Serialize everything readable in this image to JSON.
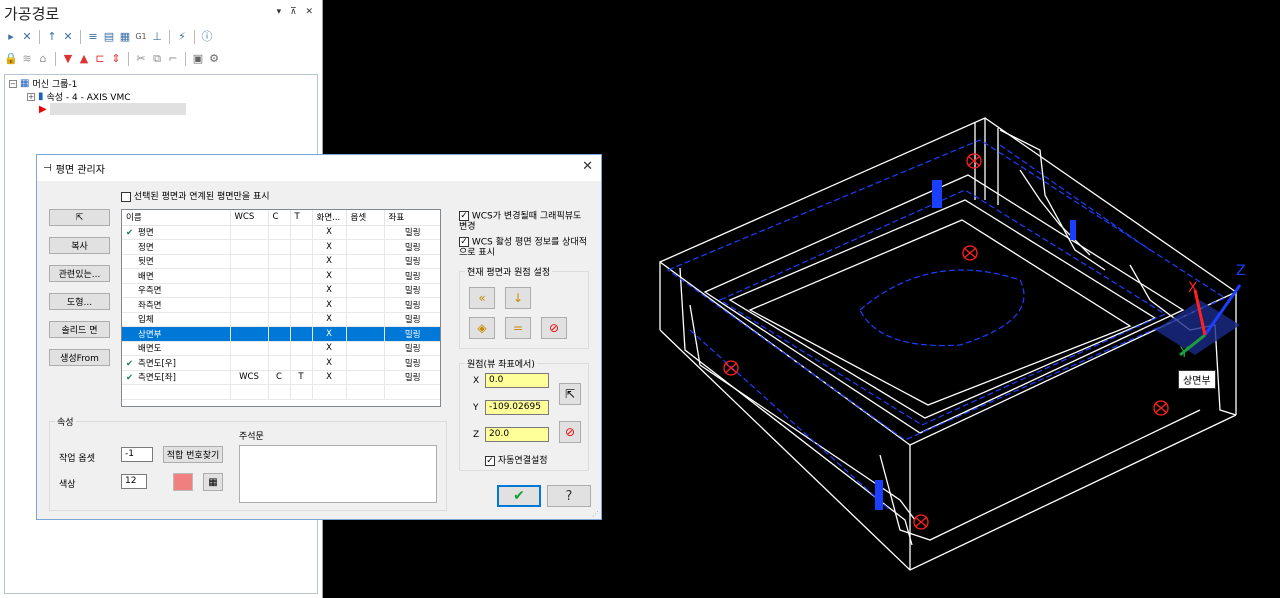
{
  "panel": {
    "title": "가공경로",
    "tree": {
      "machine_group": "머신 그룹-1",
      "properties": "속성 - 4 - AXIS VMC"
    }
  },
  "dialog": {
    "title": "평면 관리자",
    "filter_checkbox_label": "선택된 평면과 연계된 평면만을 표시",
    "left_buttons": [
      "",
      "복사",
      "관련있는...",
      "도형...",
      "솔리드 면",
      "생성From"
    ],
    "columns": [
      "이름",
      "WCS",
      "C",
      "T",
      "화면...",
      "옵셋",
      "좌표"
    ],
    "rows": [
      {
        "check": true,
        "name": "평면",
        "wcs": "",
        "c": "",
        "t": "",
        "screen": "X",
        "offset": "",
        "coord": "밀링",
        "selected": false
      },
      {
        "check": false,
        "name": "정면",
        "wcs": "",
        "c": "",
        "t": "",
        "screen": "X",
        "offset": "",
        "coord": "밀링",
        "selected": false
      },
      {
        "check": false,
        "name": "뒷면",
        "wcs": "",
        "c": "",
        "t": "",
        "screen": "X",
        "offset": "",
        "coord": "밀링",
        "selected": false
      },
      {
        "check": false,
        "name": "배면",
        "wcs": "",
        "c": "",
        "t": "",
        "screen": "X",
        "offset": "",
        "coord": "밀링",
        "selected": false
      },
      {
        "check": false,
        "name": "우측면",
        "wcs": "",
        "c": "",
        "t": "",
        "screen": "X",
        "offset": "",
        "coord": "밀링",
        "selected": false
      },
      {
        "check": false,
        "name": "좌측면",
        "wcs": "",
        "c": "",
        "t": "",
        "screen": "X",
        "offset": "",
        "coord": "밀링",
        "selected": false
      },
      {
        "check": false,
        "name": "입체",
        "wcs": "",
        "c": "",
        "t": "",
        "screen": "X",
        "offset": "",
        "coord": "밀링",
        "selected": false
      },
      {
        "check": false,
        "name": "상면부",
        "wcs": "",
        "c": "",
        "t": "",
        "screen": "X",
        "offset": "",
        "coord": "밀링",
        "selected": true
      },
      {
        "check": false,
        "name": "배면도",
        "wcs": "",
        "c": "",
        "t": "",
        "screen": "X",
        "offset": "",
        "coord": "밀링",
        "selected": false
      },
      {
        "check": true,
        "name": "측면도[우]",
        "wcs": "",
        "c": "",
        "t": "",
        "screen": "X",
        "offset": "",
        "coord": "밀링",
        "selected": false
      },
      {
        "check": true,
        "name": "측면도[좌]",
        "wcs": "WCS",
        "c": "C",
        "t": "T",
        "screen": "X",
        "offset": "",
        "coord": "밀링",
        "selected": false
      }
    ],
    "options": {
      "wcs_change_label": "WCS가 변경될때 그래픽뷰도 변경",
      "wcs_active_label": "WCS 활성 평면 정보를 상대적으로 표시"
    },
    "current_plane_group": "현재 평면과 원점 설정",
    "origin_group": "원점(뷰 좌표에서)",
    "origin": {
      "x_label": "X",
      "x": "0.0",
      "y_label": "Y",
      "y": "-109.02695",
      "z_label": "Z",
      "z": "20.0"
    },
    "auto_link_label": "자동연결설정",
    "props_group": "속성",
    "work_offset_label": "작업 옵셋",
    "work_offset_value": "-1",
    "find_number_button": "적합 번호찾기",
    "color_label": "색상",
    "color_value": "12",
    "color_swatch": "#f08080",
    "comment_label": "주석문",
    "ok_icon": "check-icon",
    "help_icon": "question-icon"
  },
  "viewport": {
    "tooltip": "상면부",
    "axes": {
      "x": "X",
      "y": "Y",
      "z": "Z"
    }
  }
}
